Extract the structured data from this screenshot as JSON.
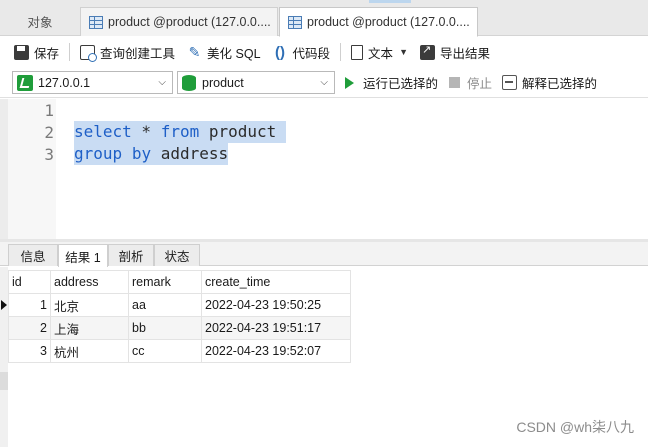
{
  "tabs": {
    "objects": "对象",
    "items": [
      {
        "label": "product @product (127.0.0...."
      },
      {
        "label": "product @product (127.0.0...."
      }
    ]
  },
  "toolbar": {
    "save": "保存",
    "query_builder": "查询创建工具",
    "beautify": "美化 SQL",
    "snippet": "代码段",
    "text": "文本",
    "export": "导出结果"
  },
  "toolbar2": {
    "connection": "127.0.0.1",
    "database": "product",
    "run_selected": "运行已选择的",
    "stop": "停止",
    "explain_selected": "解释已选择的"
  },
  "editor": {
    "line_numbers": [
      "1",
      "2",
      "3"
    ],
    "lines": [
      {
        "kw1": "select",
        "mid": " * ",
        "kw2": "from",
        "rest": " product "
      },
      {
        "kw1": "group",
        "mid": " ",
        "kw2": "by",
        "rest": " address"
      }
    ]
  },
  "result_tabs": [
    "信息",
    "结果 1",
    "剖析",
    "状态"
  ],
  "table": {
    "columns": [
      "id",
      "address",
      "remark",
      "create_time"
    ],
    "rows": [
      [
        "1",
        "北京",
        "aa",
        "2022-04-23 19:50:25"
      ],
      [
        "2",
        "上海",
        "bb",
        "2022-04-23 19:51:17"
      ],
      [
        "3",
        "杭州",
        "cc",
        "2022-04-23 19:52:07"
      ]
    ]
  },
  "watermark": "CSDN @wh柒八九"
}
